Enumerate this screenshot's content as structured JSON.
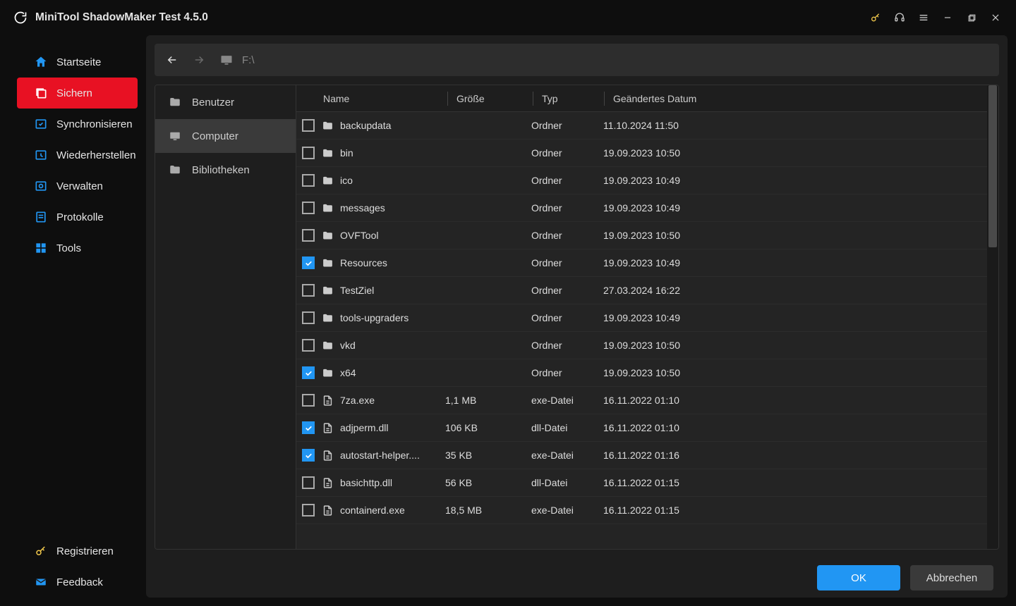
{
  "app": {
    "title": "MiniTool ShadowMaker Test 4.5.0"
  },
  "sidebar": {
    "items": [
      {
        "label": "Startseite"
      },
      {
        "label": "Sichern"
      },
      {
        "label": "Synchronisieren"
      },
      {
        "label": "Wiederherstellen"
      },
      {
        "label": "Verwalten"
      },
      {
        "label": "Protokolle"
      },
      {
        "label": "Tools"
      }
    ],
    "bottom": [
      {
        "label": "Registrieren"
      },
      {
        "label": "Feedback"
      }
    ]
  },
  "path": {
    "text": "F:\\"
  },
  "tree": {
    "items": [
      {
        "label": "Benutzer"
      },
      {
        "label": "Computer"
      },
      {
        "label": "Bibliotheken"
      }
    ]
  },
  "columns": {
    "name": "Name",
    "size": "Größe",
    "type": "Typ",
    "date": "Geändertes Datum"
  },
  "files": [
    {
      "checked": false,
      "kind": "folder",
      "name": "backupdata",
      "size": "",
      "type": "Ordner",
      "date": "11.10.2024 11:50"
    },
    {
      "checked": false,
      "kind": "folder",
      "name": "bin",
      "size": "",
      "type": "Ordner",
      "date": "19.09.2023 10:50"
    },
    {
      "checked": false,
      "kind": "folder",
      "name": "ico",
      "size": "",
      "type": "Ordner",
      "date": "19.09.2023 10:49"
    },
    {
      "checked": false,
      "kind": "folder",
      "name": "messages",
      "size": "",
      "type": "Ordner",
      "date": "19.09.2023 10:49"
    },
    {
      "checked": false,
      "kind": "folder",
      "name": "OVFTool",
      "size": "",
      "type": "Ordner",
      "date": "19.09.2023 10:50"
    },
    {
      "checked": true,
      "kind": "folder",
      "name": "Resources",
      "size": "",
      "type": "Ordner",
      "date": "19.09.2023 10:49"
    },
    {
      "checked": false,
      "kind": "folder",
      "name": "TestZiel",
      "size": "",
      "type": "Ordner",
      "date": "27.03.2024 16:22"
    },
    {
      "checked": false,
      "kind": "folder",
      "name": "tools-upgraders",
      "size": "",
      "type": "Ordner",
      "date": "19.09.2023 10:49"
    },
    {
      "checked": false,
      "kind": "folder",
      "name": "vkd",
      "size": "",
      "type": "Ordner",
      "date": "19.09.2023 10:50"
    },
    {
      "checked": true,
      "kind": "folder",
      "name": "x64",
      "size": "",
      "type": "Ordner",
      "date": "19.09.2023 10:50"
    },
    {
      "checked": false,
      "kind": "file",
      "name": "7za.exe",
      "size": "1,1 MB",
      "type": "exe-Datei",
      "date": "16.11.2022 01:10"
    },
    {
      "checked": true,
      "kind": "file",
      "name": "adjperm.dll",
      "size": "106 KB",
      "type": "dll-Datei",
      "date": "16.11.2022 01:10"
    },
    {
      "checked": true,
      "kind": "file",
      "name": "autostart-helper....",
      "size": "35 KB",
      "type": "exe-Datei",
      "date": "16.11.2022 01:16"
    },
    {
      "checked": false,
      "kind": "file",
      "name": "basichttp.dll",
      "size": "56 KB",
      "type": "dll-Datei",
      "date": "16.11.2022 01:15"
    },
    {
      "checked": false,
      "kind": "file",
      "name": "containerd.exe",
      "size": "18,5 MB",
      "type": "exe-Datei",
      "date": "16.11.2022 01:15"
    }
  ],
  "footer": {
    "ok": "OK",
    "cancel": "Abbrechen"
  }
}
